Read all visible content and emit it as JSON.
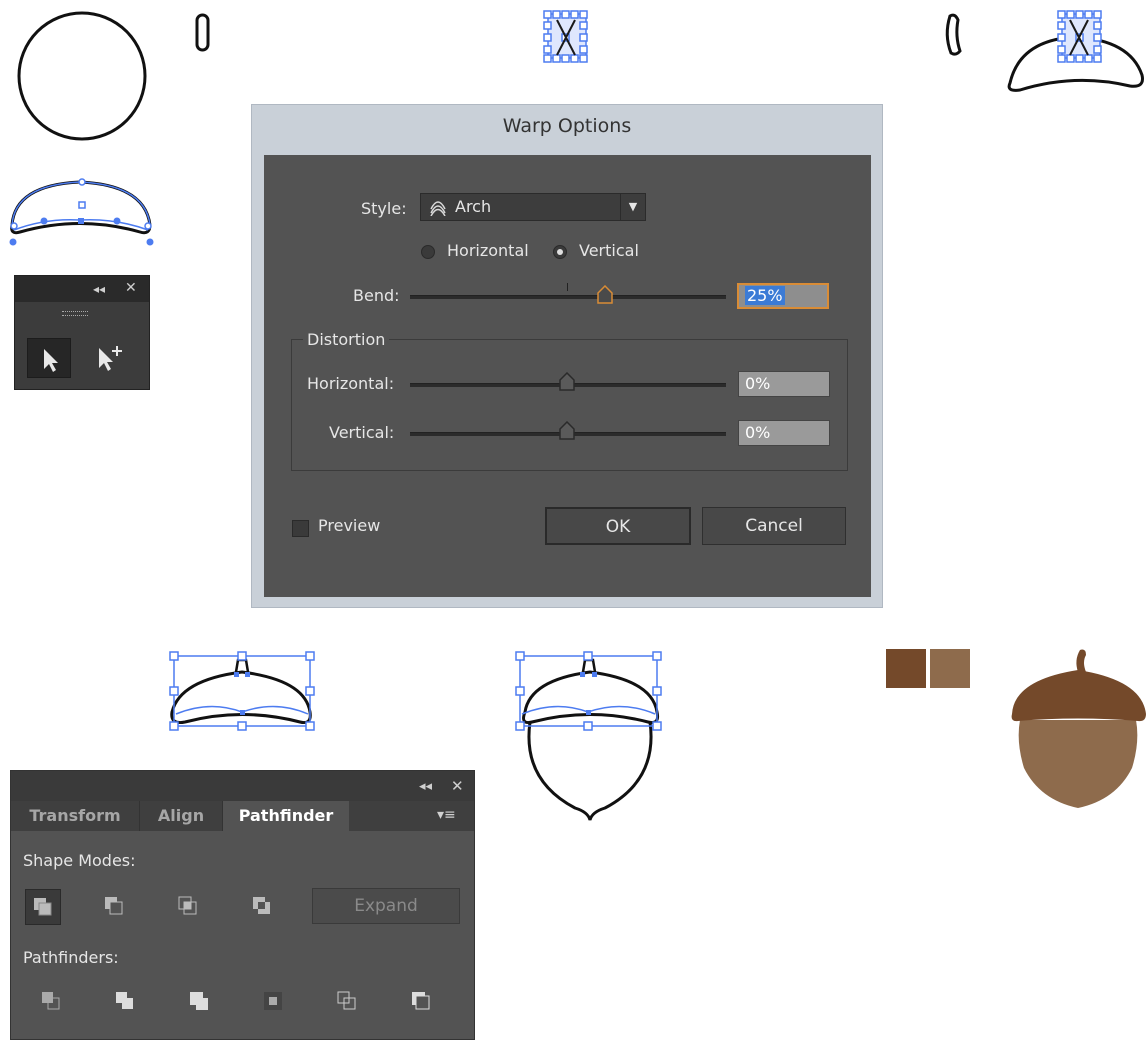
{
  "dialog": {
    "title": "Warp Options",
    "style_label": "Style:",
    "style_value": "Arch",
    "orientation_horizontal": "Horizontal",
    "orientation_vertical": "Vertical",
    "orientation_selected": "Vertical",
    "bend_label": "Bend:",
    "bend_value": "25%",
    "distortion_group": "Distortion",
    "distortion_horizontal_label": "Horizontal:",
    "distortion_horizontal_value": "0%",
    "distortion_vertical_label": "Vertical:",
    "distortion_vertical_value": "0%",
    "preview_label": "Preview",
    "ok_label": "OK",
    "cancel_label": "Cancel"
  },
  "pathfinder_panel": {
    "tabs": [
      "Transform",
      "Align",
      "Pathfinder"
    ],
    "active_tab": "Pathfinder",
    "shape_modes_label": "Shape Modes:",
    "expand_label": "Expand",
    "pathfinders_label": "Pathfinders:"
  },
  "colors": {
    "acorn_cap": "#74492a",
    "acorn_body": "#8e6b4c",
    "selection": "#4d7cf0",
    "dialog_body": "#535353"
  }
}
